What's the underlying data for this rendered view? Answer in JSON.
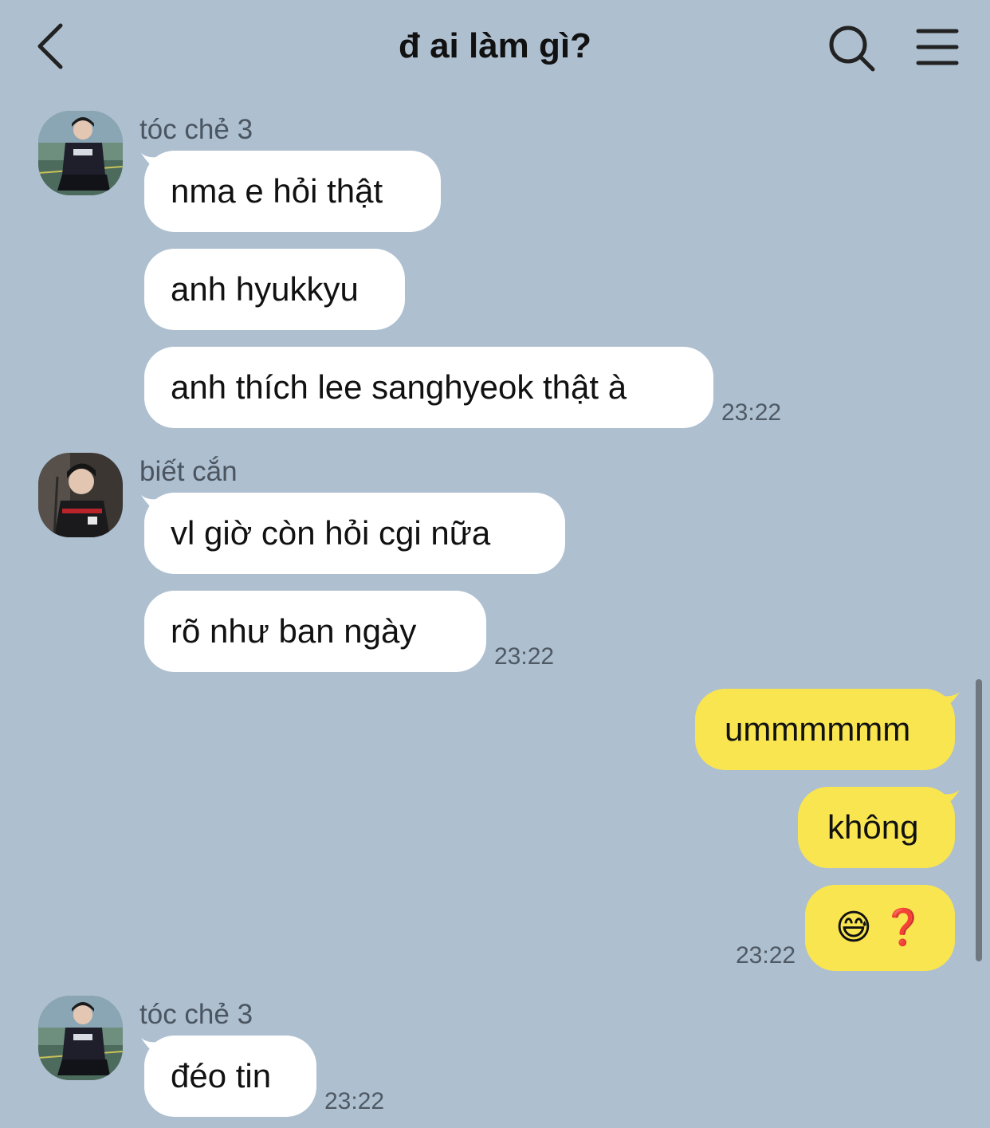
{
  "header": {
    "title": "đ ai làm gì?"
  },
  "messages": [
    {
      "sender": "tóc chẻ 3",
      "text": "nma e hỏi thật"
    },
    {
      "text": "anh hyukkyu"
    },
    {
      "text": "anh thích lee sanghyeok thật à",
      "time": "23:22"
    },
    {
      "sender": "biết cắn",
      "text": "vl giờ còn hỏi cgi nữa"
    },
    {
      "text": "rõ như ban ngày",
      "time": "23:22"
    },
    {
      "text": "ummmmmm"
    },
    {
      "text": "không"
    },
    {
      "emoji_1": "😅",
      "emoji_2": "❓",
      "time": "23:22"
    },
    {
      "sender": "tóc chẻ 3",
      "text": "đéo tin",
      "time": "23:22"
    }
  ],
  "colors": {
    "background": "#aebfd0",
    "incoming_bubble": "#ffffff",
    "outgoing_bubble": "#f9e550"
  }
}
